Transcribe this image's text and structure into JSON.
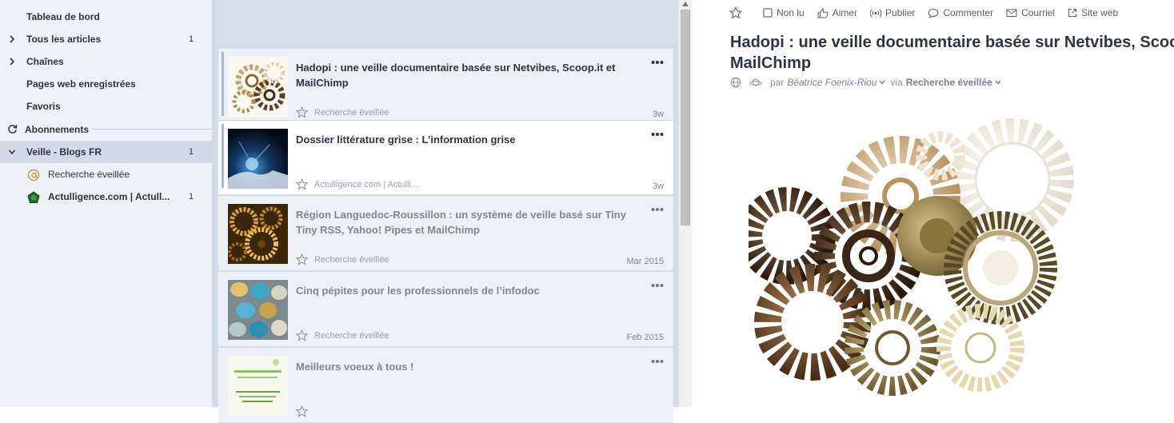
{
  "sidebar": {
    "items": [
      {
        "label": "Tableau de bord",
        "count": ""
      },
      {
        "label": "Tous les articles",
        "count": "1"
      },
      {
        "label": "Chaînes",
        "count": ""
      },
      {
        "label": "Pages web enregistrées",
        "count": ""
      },
      {
        "label": "Favoris",
        "count": ""
      }
    ],
    "section_label": "Abonnements",
    "folder": {
      "label": "Veille - Blogs FR",
      "count": "1"
    },
    "feeds": [
      {
        "label": "Recherche éveillée",
        "count": ""
      },
      {
        "label": "Actulligence.com | Actull...",
        "count": "1"
      }
    ]
  },
  "articles": [
    {
      "title": "Hadopi : une veille documentaire basée sur Netvibes, Scoop.it et MailChimp",
      "source": "Recherche éveillée",
      "age": "3w"
    },
    {
      "title": "Dossier littérature grise : L’information grise",
      "source": "Actulligence.com | Actulli...",
      "age": "3w"
    },
    {
      "title": "Région Languedoc-Roussillon : un système de veille basé sur Tiny Tiny RSS, Yahoo! Pipes et MailChimp",
      "source": "Recherche éveillée",
      "age": "Mar 2015"
    },
    {
      "title": "Cinq pépites pour les professionnels de l’infodoc",
      "source": "Recherche éveillée",
      "age": "Feb 2015"
    },
    {
      "title": "Meilleurs voeux à tous !",
      "source": "",
      "age": ""
    }
  ],
  "reader": {
    "toolbar": {
      "unread": "Non lu",
      "like": "Aimer",
      "publish": "Publier",
      "comment": "Commenter",
      "email": "Courriel",
      "website": "Site web"
    },
    "title": "Hadopi : une veille documentaire basée sur Netvibes, Scoop.it et MailChimp",
    "by_label": "par",
    "author": "Béatrice Foenix-Riou",
    "via_label": "via",
    "via_source": "Recherche éveillée"
  },
  "colors": {
    "sidebar_bg": "#eef1f7",
    "list_bg": "#d6dce7",
    "unread_rail": "#a8b7de",
    "text": "#2e3447"
  }
}
